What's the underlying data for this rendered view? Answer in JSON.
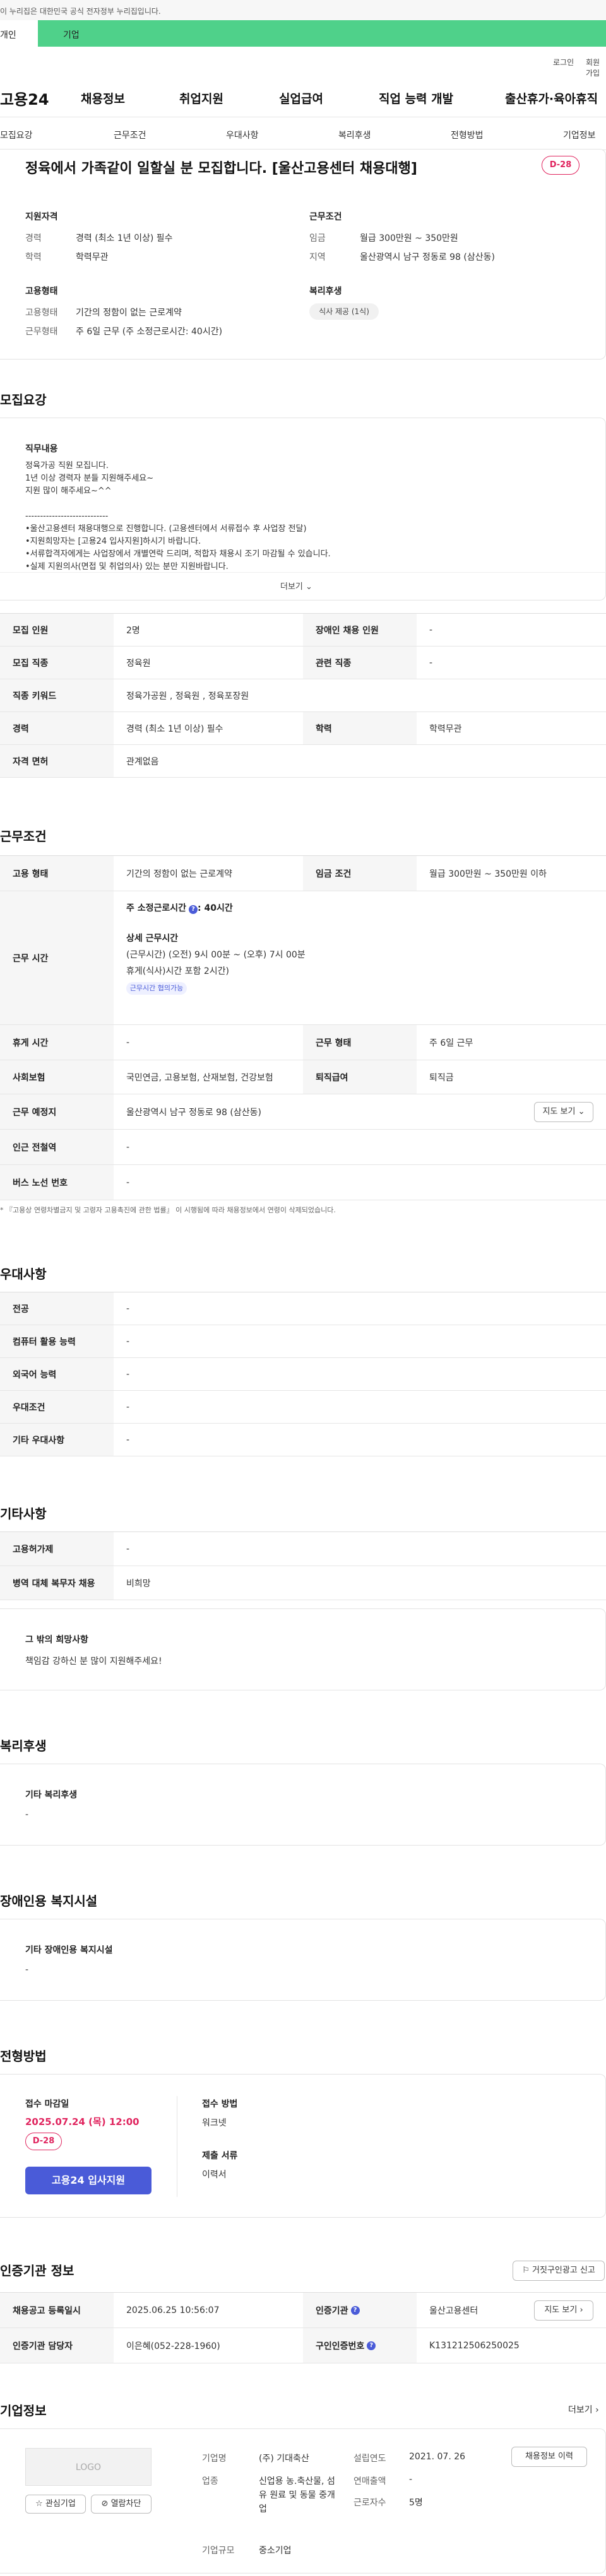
{
  "gov_bar": "이 누리집은 대한민국 공식 전자정부 누리집입니다.",
  "top_tabs": {
    "person": "개인",
    "company": "기업"
  },
  "util": {
    "login": "로그인",
    "signup": "회원가입"
  },
  "gnb": {
    "logo": "고용24",
    "menu": [
      "채용정보",
      "취업지원",
      "실업급여",
      "직업 능력 개발",
      "출산휴가·육아휴직"
    ]
  },
  "snb": [
    "모집요강",
    "근무조건",
    "우대사항",
    "복리후생",
    "전형방법",
    "기업정보"
  ],
  "header": {
    "title": "정육에서 가족같이 일할실 분 모집합니다. [울산고용센터 채용대행]",
    "dday": "D-28",
    "qual_title": "지원자격",
    "work_title": "근무조건",
    "emp_title": "고용형태",
    "welfare_title": "복리후생",
    "qual": [
      {
        "k": "경력",
        "v": "경력 (최소 1년 이상) 필수"
      },
      {
        "k": "학력",
        "v": "학력무관"
      }
    ],
    "work": [
      {
        "k": "임금",
        "v": "월급 300만원 ~ 350만원"
      },
      {
        "k": "지역",
        "v": "울산광역시 남구 정동로 98 (삼산동)"
      }
    ],
    "emp": [
      {
        "k": "고용형태",
        "v": "기간의 정함이 없는 근로계약"
      },
      {
        "k": "근무형태",
        "v": "주 6일 근무 (주 소정근로시간: 40시간)"
      }
    ],
    "welfare_chip": "식사 제공 (1식)"
  },
  "recruit": {
    "title": "모집요강",
    "duty_title": "직무내용",
    "duty_text": "정육가공 직원 모집니다.\n1년 이상 경력자 분들 지원해주세요~\n지원 많이 해주세요~^^\n\n----------------------------\n•울산고용센터 채용대행으로 진행합니다. (고용센터에서 서류접수 후 사업장 전달)\n•지원희망자는 [고용24 입사지원]하시기 바랍니다.\n•서류합격자에게는 사업장에서 개별연락 드리며, 적합자 채용시 조기 마감될 수 있습니다.\n•실제 지원의사(면접 및 취업의사) 있는 분만 지원바랍니다.",
    "more": "더보기",
    "rows": [
      {
        "k1": "모집 인원",
        "v1": "2명",
        "k2": "장애인 채용 인원",
        "v2": "-"
      },
      {
        "k1": "모집 직종",
        "v1": "정육원",
        "k2": "관련 직종",
        "v2": "-"
      },
      {
        "k1": "직종 키워드",
        "v1": "정육가공원 , 정육원 , 정육포장원"
      },
      {
        "k1": "경력",
        "v1": "경력 (최소 1년 이상) 필수",
        "k2": "학력",
        "v2": "학력무관"
      },
      {
        "k1": "자격 면허",
        "v1": "관계없음"
      }
    ]
  },
  "conditions": {
    "title": "근무조건",
    "emp_k": "고용 형태",
    "emp_v": "기간의 정함이 없는 근로계약",
    "wage_k": "임금 조건",
    "wage_v": "월급 300만원 ~ 350만원 이하",
    "time_k": "근무 시간",
    "time_weekly": "주 소정근로시간",
    "time_weekly_v": ": 40시간",
    "time_detail_title": "상세 근무시간",
    "time_detail_1": "(근무시간) (오전) 9시 00분 ~ (오후) 7시 00분",
    "time_detail_2": "휴게(식사)시간 포함 2시간)",
    "time_tag": "근무시간 협의가능",
    "rest_k": "휴게 시간",
    "rest_v": "-",
    "shape_k": "근무 형태",
    "shape_v": "주 6일 근무",
    "ins_k": "사회보험",
    "ins_v": "국민연금, 고용보험, 산재보험, 건강보험",
    "ret_k": "퇴직급여",
    "ret_v": "퇴직금",
    "place_k": "근무 예정지",
    "place_v": "울산광역시 남구 정동로 98 (삼산동)",
    "map_btn": "지도 보기",
    "sub_k": "인근 전철역",
    "sub_v": "-",
    "bus_k": "버스 노선 번호",
    "bus_v": "-",
    "note": "* 『고용상 연령차별금지 및 고령자 고용촉진에 관한 법률』 이 시행됨에 따라 채용정보에서 연령이 삭제되었습니다."
  },
  "prefer": {
    "title": "우대사항",
    "rows": [
      {
        "k": "전공",
        "v": "-"
      },
      {
        "k": "컴퓨터 활용 능력",
        "v": "-"
      },
      {
        "k": "외국어 능력",
        "v": "-"
      },
      {
        "k": "우대조건",
        "v": "-"
      },
      {
        "k": "기타 우대사항",
        "v": "-"
      }
    ]
  },
  "etc": {
    "title": "기타사항",
    "rows": [
      {
        "k": "고용허가제",
        "v": "-"
      },
      {
        "k": "병역 대체 복무자 채용",
        "v": "비희망"
      }
    ],
    "wish_title": "그 밖의 희망사항",
    "wish_text": "책임감 강하신 분 많이 지원해주세요!"
  },
  "welfare": {
    "title": "복리후생",
    "box_title": "기타 복리후생",
    "box_value": "-"
  },
  "disabled": {
    "title": "장애인용 복지시설",
    "box_title": "기타 장애인용 복지시설",
    "box_value": "-"
  },
  "process": {
    "title": "전형방법",
    "deadline_title": "접수 마감일",
    "deadline": "2025.07.24 (목) 12:00",
    "dday": "D-28",
    "apply_btn": "고용24 입사지원",
    "method_title": "접수 방법",
    "method": "워크넷",
    "docs_title": "제출 서류",
    "docs": "이력서"
  },
  "agency": {
    "title": "인증기관 정보",
    "report_btn": "거짓구인광고 신고",
    "reg_k": "채용공고 등록일시",
    "reg_v": "2025.06.25 10:56:07",
    "org_k": "인증기관",
    "org_v": "울산고용센터",
    "map_btn": "지도 보기",
    "mgr_k": "인증기관 담당자",
    "mgr_v": "이은혜(052-228-1960)",
    "num_k": "구인인증번호",
    "num_v": "K131212506250025"
  },
  "company": {
    "title": "기업정보",
    "more": "더보기",
    "logo": "LOGO",
    "fav_btn": "관심기업",
    "block_btn": "열람차단",
    "name_k": "기업명",
    "name_v": "(주) 기대축산",
    "biz_k": "업종",
    "biz_v": "신업용 농.축산물, 섬유 원료 및 동물 중개업",
    "size_k": "기업규모",
    "size_v": "중소기업",
    "est_k": "설립연도",
    "est_v": "2021. 07. 26",
    "sales_k": "연매출액",
    "sales_v": "-",
    "emp_k": "근로자수",
    "emp_v": "5명",
    "history_btn": "채용정보 이력"
  }
}
